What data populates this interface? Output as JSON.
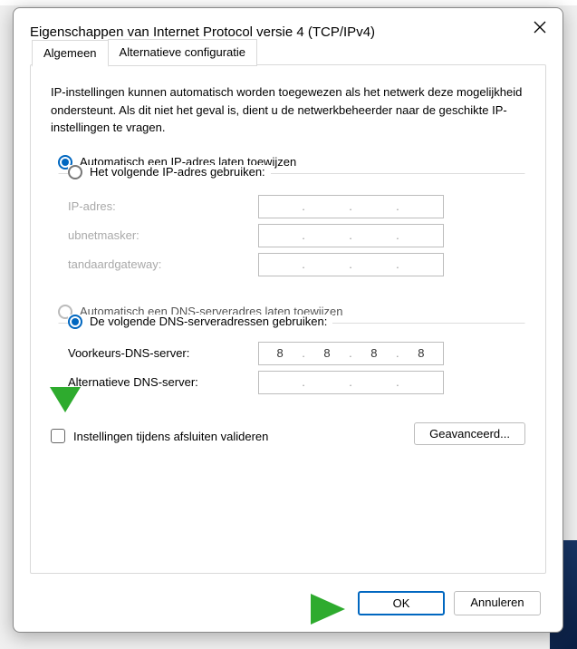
{
  "title": "Eigenschappen van Internet Protocol versie 4 (TCP/IPv4)",
  "tabs": {
    "general": "Algemeen",
    "alt": "Alternatieve configuratie"
  },
  "desc": "IP-instellingen kunnen automatisch worden toegewezen als het netwerk deze mogelijkheid ondersteunt. Als dit niet het geval is, dient u de netwerkbeheerder naar de geschikte IP-instellingen te vragen.",
  "ip": {
    "auto": "Automatisch een IP-adres laten toewijzen",
    "manual": "Het volgende IP-adres gebruiken:",
    "addr": "IP-adres:",
    "mask": "ubnetmasker:",
    "gw": "tandaardgateway:"
  },
  "dns": {
    "auto": "Automatisch een DNS-serveradres laten toewijzen",
    "manual": "De volgende DNS-serveradressen gebruiken:",
    "pref": "Voorkeurs-DNS-server:",
    "alt": "Alternatieve DNS-server:",
    "pref_val": {
      "a": "8",
      "b": "8",
      "c": "8",
      "d": "8"
    }
  },
  "validate": "Instellingen tijdens afsluiten valideren",
  "advanced": "Geavanceerd...",
  "ok": "OK",
  "cancel": "Annuleren"
}
